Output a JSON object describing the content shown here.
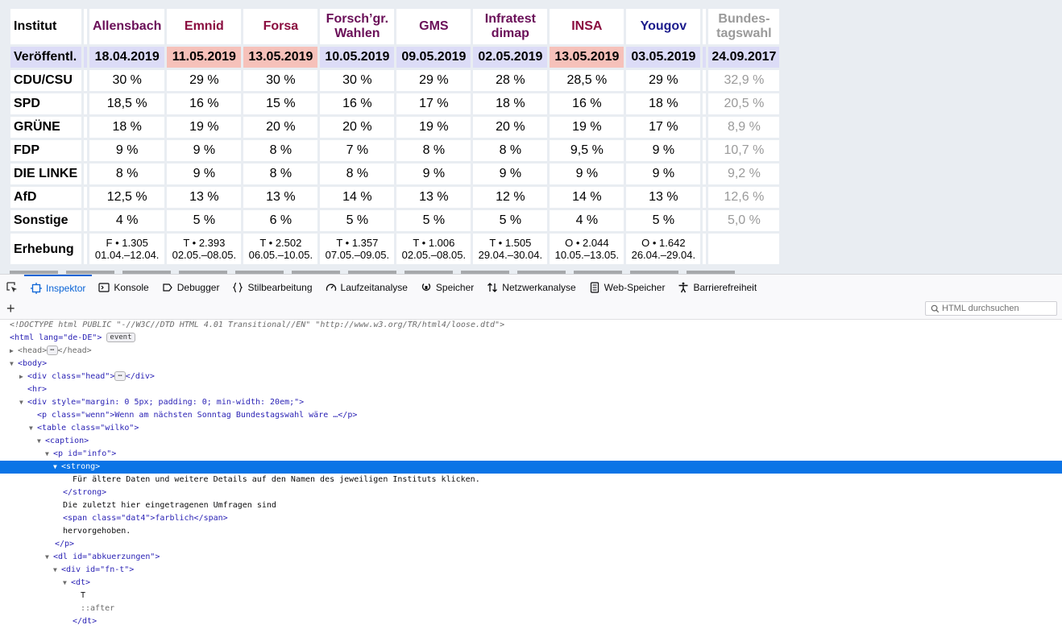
{
  "table": {
    "corner": "Institut",
    "institutes": [
      "Allensbach",
      "Emnid",
      "Forsa",
      "Forsch’gr.\nWahlen",
      "GMS",
      "Infratest\ndimap",
      "INSA",
      "Yougov"
    ],
    "institute_colors": [
      "#6a0f58",
      "#8a0d3f",
      "#8a0d3f",
      "#6a0f58",
      "#6a0f58",
      "#6a0f58",
      "#8a0d3f",
      "#1b1b8c"
    ],
    "election_header": "Bundes-\ntagswahl",
    "dates_label": "Veröffentl.",
    "dates": [
      "18.04.2019",
      "11.05.2019",
      "13.05.2019",
      "10.05.2019",
      "09.05.2019",
      "02.05.2019",
      "13.05.2019",
      "03.05.2019"
    ],
    "dates_highlight": [
      false,
      true,
      true,
      false,
      false,
      false,
      true,
      false
    ],
    "election_date": "24.09.2017",
    "parties": [
      {
        "name": "CDU/CSU",
        "values": [
          "30 %",
          "29 %",
          "30 %",
          "30 %",
          "29 %",
          "28 %",
          "28,5 %",
          "29 %"
        ],
        "election": "32,9 %"
      },
      {
        "name": "SPD",
        "values": [
          "18,5 %",
          "16 %",
          "15 %",
          "16 %",
          "17 %",
          "18 %",
          "16 %",
          "18 %"
        ],
        "election": "20,5 %"
      },
      {
        "name": "GRÜNE",
        "values": [
          "18 %",
          "19 %",
          "20 %",
          "20 %",
          "19 %",
          "20 %",
          "19 %",
          "17 %"
        ],
        "election": "8,9 %"
      },
      {
        "name": "FDP",
        "values": [
          "9 %",
          "9 %",
          "8 %",
          "7 %",
          "8 %",
          "8 %",
          "9,5 %",
          "9 %"
        ],
        "election": "10,7 %"
      },
      {
        "name": "DIE LINKE",
        "values": [
          "8 %",
          "9 %",
          "8 %",
          "8 %",
          "9 %",
          "9 %",
          "9 %",
          "9 %"
        ],
        "election": "9,2 %"
      },
      {
        "name": "AfD",
        "values": [
          "12,5 %",
          "13 %",
          "13 %",
          "14 %",
          "13 %",
          "12 %",
          "14 %",
          "13 %"
        ],
        "election": "12,6 %"
      },
      {
        "name": "Sonstige",
        "values": [
          "4 %",
          "5 %",
          "6 %",
          "5 %",
          "5 %",
          "5 %",
          "4 %",
          "5 %"
        ],
        "election": "5,0 %"
      }
    ],
    "survey_label": "Erhebung",
    "survey": [
      {
        "a": "F • 1.305",
        "b": "01.04.–12.04."
      },
      {
        "a": "T • 2.393",
        "b": "02.05.–08.05."
      },
      {
        "a": "T • 2.502",
        "b": "06.05.–10.05."
      },
      {
        "a": "T • 1.357",
        "b": "07.05.–09.05."
      },
      {
        "a": "T • 1.006",
        "b": "02.05.–08.05."
      },
      {
        "a": "T • 1.505",
        "b": "29.04.–30.04."
      },
      {
        "a": "O • 2.044",
        "b": "10.05.–13.05."
      },
      {
        "a": "O • 1.642",
        "b": "26.04.–29.04."
      }
    ]
  },
  "devtools": {
    "tabs": [
      {
        "label": "Inspektor",
        "name": "tab-inspector",
        "icon": "inspector-icon"
      },
      {
        "label": "Konsole",
        "name": "tab-console",
        "icon": "console-icon"
      },
      {
        "label": "Debugger",
        "name": "tab-debugger",
        "icon": "debugger-icon"
      },
      {
        "label": "Stilbearbeitung",
        "name": "tab-style-editor",
        "icon": "braces-icon"
      },
      {
        "label": "Laufzeitanalyse",
        "name": "tab-performance",
        "icon": "gauge-icon"
      },
      {
        "label": "Speicher",
        "name": "tab-memory",
        "icon": "memory-icon"
      },
      {
        "label": "Netzwerkanalyse",
        "name": "tab-network",
        "icon": "network-icon"
      },
      {
        "label": "Web-Speicher",
        "name": "tab-storage",
        "icon": "storage-icon"
      },
      {
        "label": "Barrierefreiheit",
        "name": "tab-accessibility",
        "icon": "accessibility-icon"
      }
    ],
    "selected_tab": "Inspektor",
    "accent": "#0a64d6",
    "search_placeholder": "HTML durchsuchen"
  },
  "tree": {
    "doctype": "<!DOCTYPE html PUBLIC \"-//W3C//DTD HTML 4.01 Transitional//EN\" \"http://www.w3.org/TR/html4/loose.dtd\">",
    "html_open": "<html lang=\"de-DE\">",
    "event_badge": "event",
    "head": "<head>",
    "head_close": "</head>",
    "ellipsis": "⋯",
    "body_open": "<body>",
    "div_head_open": "<div class=\"head\">",
    "div_close": "</div>",
    "hr": "<hr>",
    "div_style_open": "<div style=\"margin: 0 5px; padding: 0; min-width: 20em;\">",
    "p_wenn": "<p class=\"wenn\">Wenn am nächsten Sonntag Bundestagswahl wäre …</p>",
    "table_open": "<table class=\"wilko\">",
    "caption_open": "<caption>",
    "p_info_open": "<p id=\"info\">",
    "strong_open": "<strong>",
    "strong_text": "Für ältere Daten und weitere Details auf den Namen des jeweiligen Instituts klicken.",
    "strong_close": "</strong>",
    "text_1": "Die zuletzt hier eingetragenen Umfragen sind",
    "span_line": "<span class=\"dat4\">farblich</span>",
    "text_2": "hervorgehoben.",
    "p_close": "</p>",
    "dl_open": "<dl id=\"abkuerzungen\">",
    "div_fnt_open": "<div id=\"fn-t\">",
    "dt_open": "<dt>",
    "dt_text": "T",
    "after": "::after",
    "dt_close": "</dt>"
  }
}
